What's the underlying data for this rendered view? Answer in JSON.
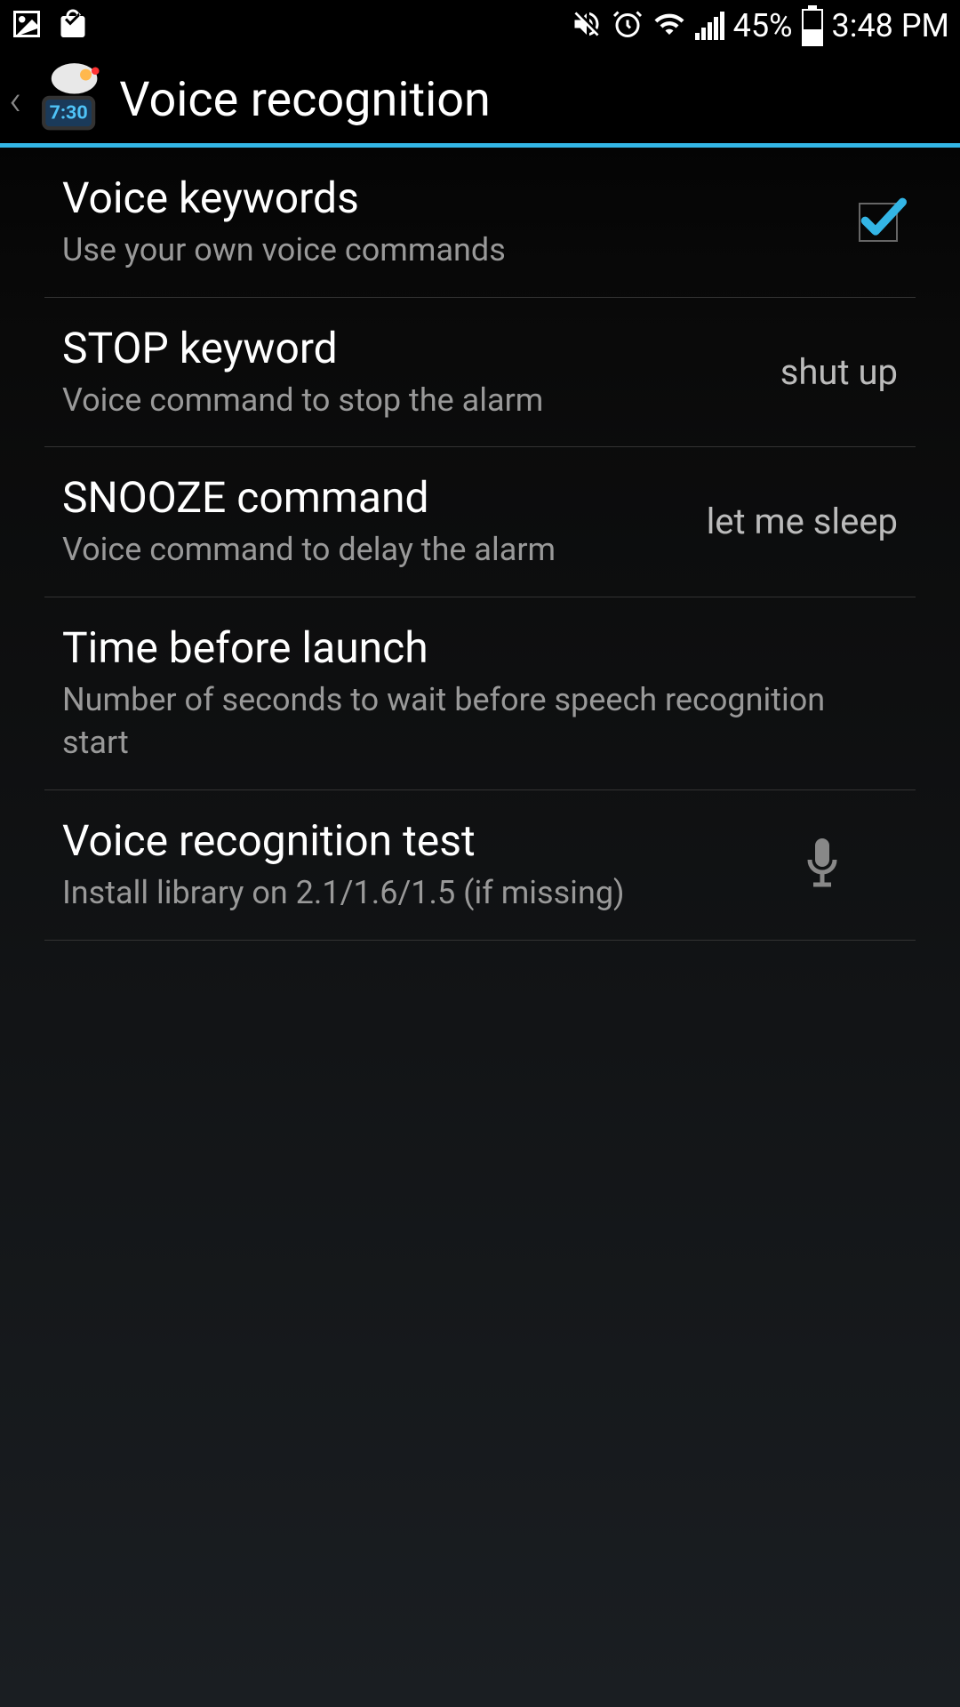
{
  "status_bar": {
    "battery_percent": "45%",
    "time": "3:48 PM"
  },
  "header": {
    "title": "Voice recognition"
  },
  "settings": {
    "voice_keywords": {
      "title": "Voice keywords",
      "subtitle": "Use your own voice commands",
      "checked": true
    },
    "stop_keyword": {
      "title": "STOP keyword",
      "subtitle": "Voice command to stop the alarm",
      "value": "shut up"
    },
    "snooze_command": {
      "title": "SNOOZE command",
      "subtitle": "Voice command to delay the alarm",
      "value": "let me sleep"
    },
    "time_before_launch": {
      "title": "Time before launch",
      "subtitle": "Number of seconds to wait before speech recognition start"
    },
    "voice_recognition_test": {
      "title": "Voice recognition test",
      "subtitle": "Install library on 2.1/1.6/1.5 (if missing)"
    }
  }
}
